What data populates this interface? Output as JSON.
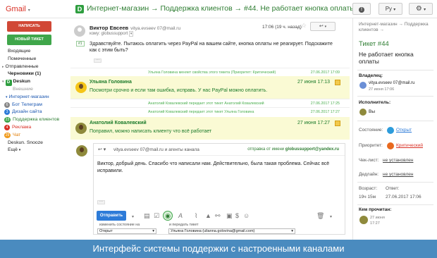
{
  "header": {
    "app_name": "Gmail",
    "app_caret": "▾",
    "thread_title": "Интернет-магазин → Поддержка клиентов → #44. Не работает кнопка оплаты",
    "lang": "Ру",
    "lang_caret": "▾",
    "settings_caret": "▾"
  },
  "sidebar": {
    "compose_label": "НАПИСАТЬ",
    "new_ticket_label": "НОВЫЙ ТИКЕТ",
    "items": [
      {
        "label": "Входящие"
      },
      {
        "label": "Помеченные"
      },
      {
        "label": "Отправленные"
      },
      {
        "label": "Черновики (1)"
      },
      {
        "label": "Deskun"
      },
      {
        "label": "Внешние"
      },
      {
        "label": "Интернет-магазин"
      },
      {
        "label": "Бот Телеграм",
        "badge": "6"
      },
      {
        "label": "Дизайн сайта",
        "badge": "3"
      },
      {
        "label": "Поддержка клиентов",
        "badge": "23"
      },
      {
        "label": "Реклама",
        "badge": "4"
      },
      {
        "label": "Чат",
        "badge": "29"
      },
      {
        "label": "Deskun. Snooze"
      },
      {
        "label": "Ещё"
      }
    ]
  },
  "message": {
    "sender_name": "Виктор Евсеев",
    "sender_email": "vitya.evseev 07@mail.ru",
    "to_line": "кому: globussupport",
    "time": "17:06 (19 ч. назад)",
    "number_tag": "#1",
    "body": "Здравствуйте. Пытаюсь оплатить через PayPal на вашем сайте, кнопка оплаты не реагирует. Подскажите как с этим быть?",
    "ellipsis": "···"
  },
  "system_lines": [
    {
      "text": "Ульяна Головина меняет свойства этого тикета (Приоритет: Критический)",
      "date": "27.06.2017 17:09"
    },
    {
      "text": "Анатолий Ковалевский передает этот тикет Анатолий Ковалевский",
      "date": "27.06.2017 17:25"
    },
    {
      "text": "Анатолий Ковалевский передает этот тикет Ульяна Головина",
      "date": "27.06.2017 17:27"
    }
  ],
  "notes": [
    {
      "name": "Ульяна Головина",
      "text": "Посмотри срочно и если там ошибка, исправь. У нас PayPal можно оплатить.",
      "time": "27 июня 17:13"
    },
    {
      "name": "Анатолий Ковалевский",
      "text": "Поправил, можно написать клиенту что всё работает",
      "time": "27 июня 17:27"
    }
  ],
  "composer": {
    "reply_icon": "↩ ▾",
    "to": "vitya.evseev 07@mail.ru и агенты канала",
    "from_prefix": "отправка от имени",
    "from_email": "globussupport@yandex.ru",
    "body": "Виктор, добрый день. Спасибо что написали нам. Действительно, была такая проблема. Сейчас всё исправили.",
    "ellipsis": "···",
    "send_label": "Отправить",
    "status_label": "изменить состояние на",
    "status_value": "Открыт",
    "assign_label": "и передать тикет",
    "assign_value": "Ульяна Головина (ulianna.golovina@gmail.com)",
    "select_caret": "▾"
  },
  "details": {
    "breadcrumb": "Интернет-магазин → Поддержка клиентов →",
    "ticket_id": "Тикет #44",
    "subject": "Не работает кнопка оплаты",
    "owner_label": "Владелец:",
    "owner_email": "vitya.evseev 07@mail.ru",
    "owner_sub": "27 июня 17:06",
    "assignee_label": "Исполнитель:",
    "assignee_name": "Вы",
    "status_label": "Состояние:",
    "status_value": "Открыт",
    "priority_label": "Приоритет:",
    "priority_value": "Критический",
    "checklist_label": "Чек-лист:",
    "checklist_value": "не установлен",
    "deadline_label": "Дедлайн:",
    "deadline_value": "не установлен",
    "age_label": "Возраст:",
    "age_value": "19ч 15м",
    "response_label": "Ответ:",
    "response_value": "27.06.2017 17:06",
    "read_by_label": "Кем прочитан:",
    "read_by_date": "27 июня",
    "read_by_time": "17:27"
  },
  "caption": "Интерфейс системы поддержки с настроенными каналами",
  "colors": {
    "accent_green": "#2e7d32",
    "send_blue": "#2d7bd8",
    "priority_red": "#d93025",
    "caption_bg": "#4a8bbf"
  }
}
